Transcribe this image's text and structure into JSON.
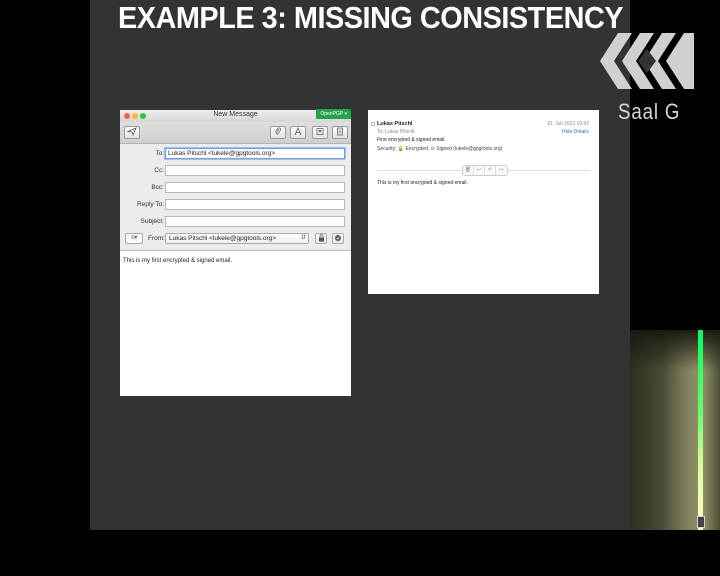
{
  "slide": {
    "title": "EXAMPLE 3:  MISSING CONSISTENCY",
    "room_label": "Saal G"
  },
  "compose": {
    "window_title": "New Message",
    "openpgp_label": "OpenPGP ▾",
    "toolbar": {
      "send_icon": "paper-plane-icon",
      "attach_icon": "paperclip-icon",
      "format_icon": "font-icon",
      "photo_icon": "photo-browser-icon",
      "template_icon": "stationery-icon"
    },
    "fields": {
      "to_label": "To:",
      "to_value": "Lukas Pitschl <lukele@gpgtools.org>",
      "cc_label": "Cc:",
      "cc_value": "",
      "bcc_label": "Bcc:",
      "bcc_value": "",
      "replyto_label": "Reply To:",
      "replyto_value": "",
      "subject_label": "Subject:",
      "subject_value": "",
      "from_label": "From:",
      "from_value": "Lukas Pitschl <lukele@gpgtools.org>"
    },
    "body": "This is my first encrypted & signed email."
  },
  "viewer": {
    "sender": "Lukas Pitschl",
    "date": "10. Juli 2013 19:42",
    "hide_details": "Hide Details",
    "to_line": "To:  Lukas Pitschl",
    "subject": "First encrypted & signed email",
    "security": "Security:   🔒 Encrypted,  ⊙ Signed (lukele@gpgtools.org)",
    "body": "This is my first encrypted & signed email."
  }
}
